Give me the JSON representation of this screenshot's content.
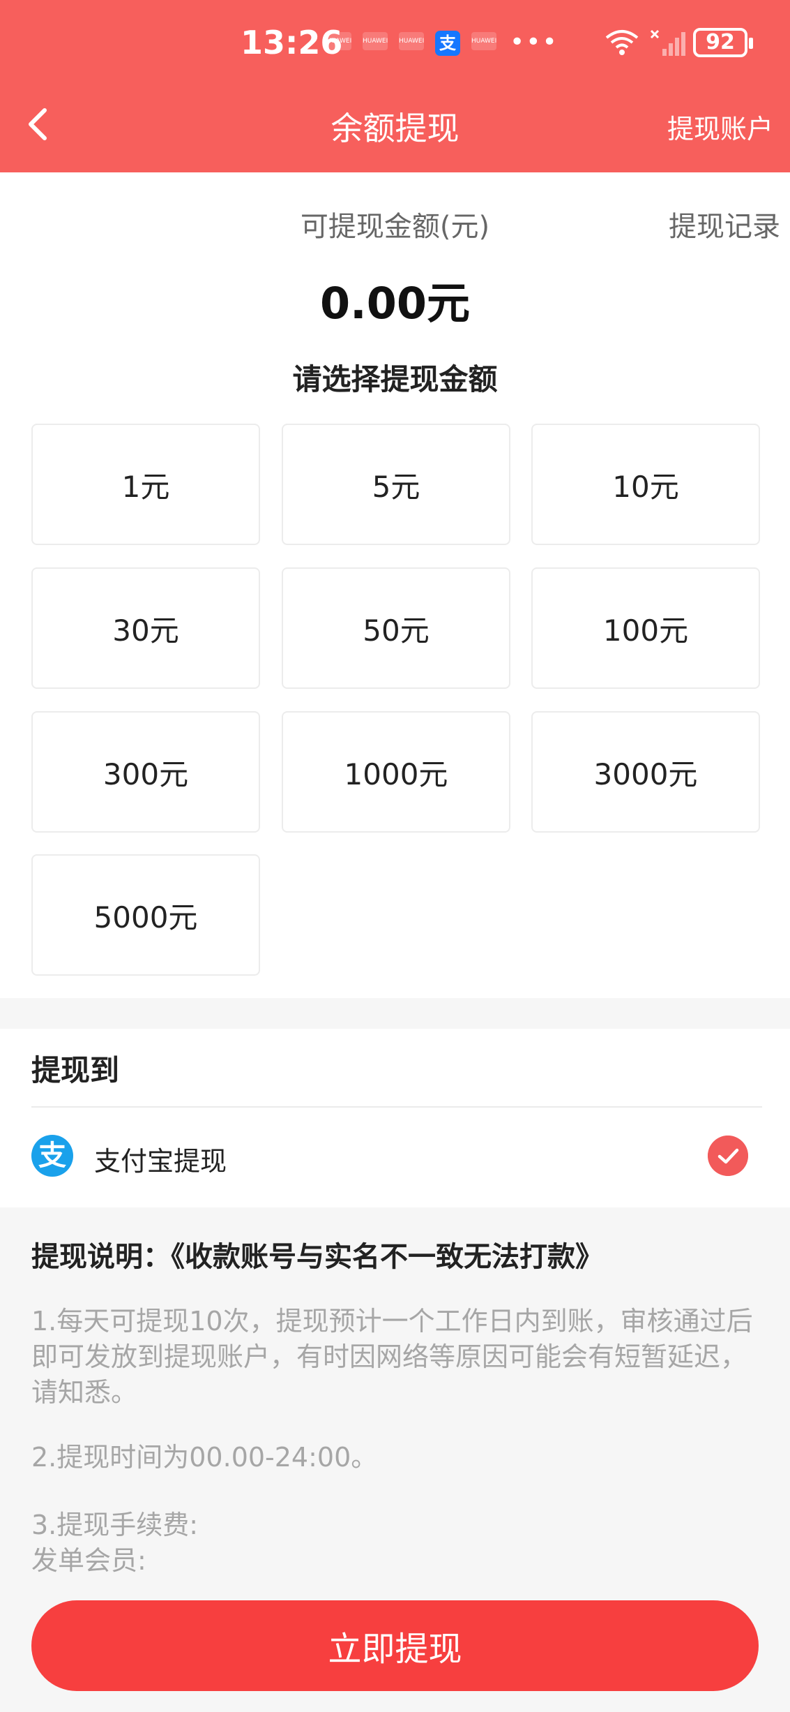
{
  "status_bar": {
    "time": "13:26",
    "notifications": [
      "HUAWEI",
      "HUAWEI",
      "HUAWEI",
      "HUAWEI"
    ],
    "alipay_glyph": "支",
    "more": "•••",
    "battery": "92"
  },
  "header": {
    "title": "余额提现",
    "account_link": "提现账户"
  },
  "balance": {
    "label": "可提现金额(元)",
    "records_link": "提现记录",
    "amount": "0.00元"
  },
  "selector": {
    "title": "请选择提现金额",
    "options": [
      "1元",
      "5元",
      "10元",
      "30元",
      "50元",
      "100元",
      "300元",
      "1000元",
      "3000元",
      "5000元"
    ]
  },
  "withdraw_to": {
    "title": "提现到",
    "method_glyph": "支",
    "method_label": "支付宝提现"
  },
  "notes": {
    "title": "提现说明：《收款账号与实名不一致无法打款》",
    "item1": "1.每天可提现10次，提现预计一个工作日内到账，审核通过后即可发放到提现账户，有时因网络等原因可能会有短暂延迟，请知悉。",
    "item2": "2.提现时间为00.00-24:00。",
    "item3_line1": "3.提现手续费:",
    "item3_line2": "发单会员:"
  },
  "submit_label": "立即提现",
  "colors": {
    "header": "#f75f5c",
    "button": "#f73f3f",
    "check": "#f25a5a",
    "alipay": "#1aa1eb"
  }
}
